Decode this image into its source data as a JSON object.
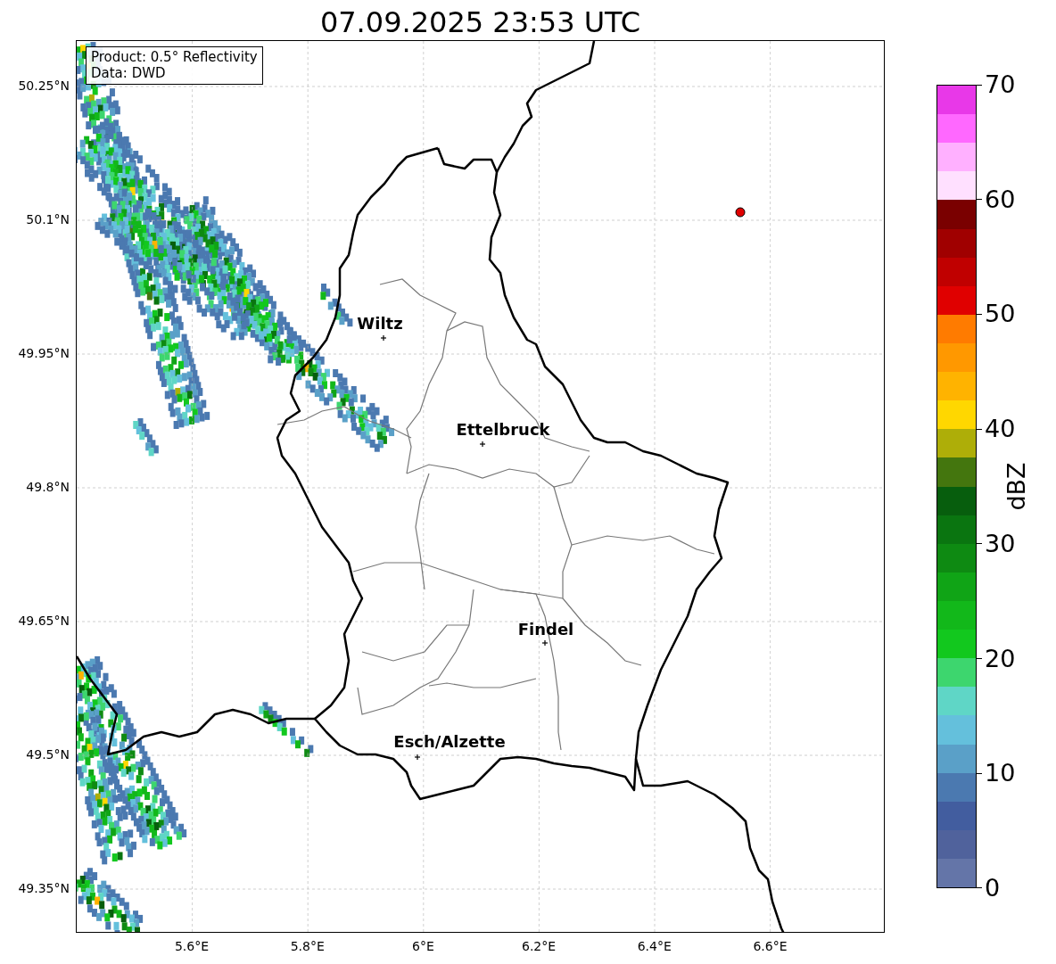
{
  "title": "07.09.2025 23:53 UTC",
  "info_box": {
    "lines": [
      "Product: 0.5° Reflectivity",
      "Data: DWD"
    ]
  },
  "map": {
    "lat_ticks": [
      "50.25°N",
      "50.1°N",
      "49.95°N",
      "49.8°N",
      "49.65°N",
      "49.5°N",
      "49.35°N"
    ],
    "lon_ticks": [
      "5.6°E",
      "5.8°E",
      "6°E",
      "6.2°E",
      "6.4°E",
      "6.6°E"
    ],
    "cities": [
      {
        "name": "Wiltz"
      },
      {
        "name": "Ettelbruck"
      },
      {
        "name": "Findel"
      },
      {
        "name": "Esch/Alzette"
      }
    ]
  },
  "colorbar": {
    "ticks": [
      "70",
      "60",
      "50",
      "40",
      "30",
      "20",
      "10",
      "0"
    ],
    "label": "dBZ",
    "bins": [
      {
        "color": "#e838e8"
      },
      {
        "color": "#ff68ff"
      },
      {
        "color": "#ffb0ff"
      },
      {
        "color": "#ffe0ff"
      },
      {
        "color": "#7a0000"
      },
      {
        "color": "#a00000"
      },
      {
        "color": "#c00000"
      },
      {
        "color": "#e00000"
      },
      {
        "color": "#ff7b00"
      },
      {
        "color": "#ff9800"
      },
      {
        "color": "#ffb300"
      },
      {
        "color": "#ffd700"
      },
      {
        "color": "#aeae08"
      },
      {
        "color": "#44760e"
      },
      {
        "color": "#075e0d"
      },
      {
        "color": "#0a7510"
      },
      {
        "color": "#0e8a12"
      },
      {
        "color": "#10a416"
      },
      {
        "color": "#12b81a"
      },
      {
        "color": "#12c81e"
      },
      {
        "color": "#3dd66e"
      },
      {
        "color": "#5fd6c6"
      },
      {
        "color": "#64c0dc"
      },
      {
        "color": "#5aa0c8"
      },
      {
        "color": "#4b79b0"
      },
      {
        "color": "#425d9f"
      },
      {
        "color": "#50629c"
      },
      {
        "color": "#6475a8"
      }
    ]
  }
}
